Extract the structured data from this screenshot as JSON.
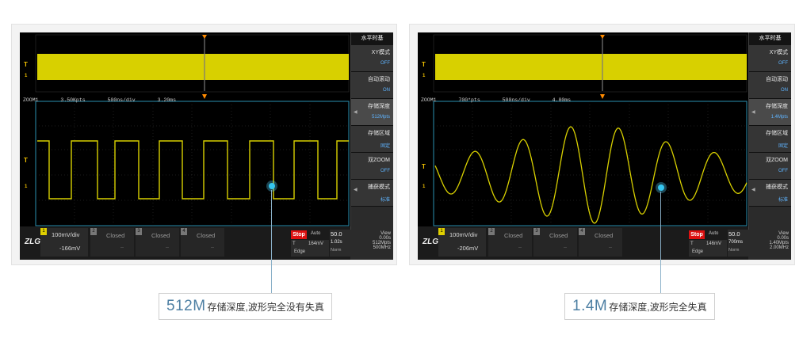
{
  "colors": {
    "trace": "#d8d000",
    "accent": "#4d7fa3",
    "stop": "#d11111"
  },
  "panels": [
    {
      "zoom_info": {
        "zoom": "ZOOM1",
        "pts": "3.50Kpts",
        "tdiv": "500ns/div",
        "pos": "3.20ms"
      },
      "menu": {
        "title": "水平时基",
        "items": [
          {
            "label": "XY模式",
            "value": "OFF"
          },
          {
            "label": "自动滚动",
            "value": "ON"
          },
          {
            "label": "存储深度",
            "value": "512Mpts"
          },
          {
            "label": "存储区域",
            "value": "固定"
          },
          {
            "label": "双ZOOM",
            "value": "OFF"
          },
          {
            "label": "捕获模式",
            "value": "标准"
          }
        ]
      },
      "bottom": {
        "logo": "ZLG",
        "ch1_num": "1",
        "ch1_scale": "100mV/div",
        "ch1_offset": "-166mV",
        "closed": [
          {
            "num": "2",
            "label": "Closed"
          },
          {
            "num": "3",
            "label": "Closed"
          },
          {
            "num": "4",
            "label": "Closed"
          }
        ],
        "closed_dash": "--",
        "stop": "Stop",
        "trig_mode": "Auto",
        "trig_t": "T",
        "trig_level": "164mV",
        "trig_type": "Edge",
        "tdiv": "1.02s",
        "norm": "Norm",
        "tb_value": "50.0",
        "tb_unit": "mV div",
        "view": "View",
        "view_t": "0.00s",
        "rec_len": "512Mpts",
        "rate": "500MHz"
      },
      "callout": {
        "big": "512M",
        "small": "存储深度,波形完全没有失真"
      }
    },
    {
      "zoom_info": {
        "zoom": "ZOOM1",
        "pts": "700*pts",
        "tdiv": "500ns/div",
        "pos": "4.80ms"
      },
      "menu": {
        "title": "水平时基",
        "items": [
          {
            "label": "XY模式",
            "value": "OFF"
          },
          {
            "label": "自动滚动",
            "value": "ON"
          },
          {
            "label": "存储深度",
            "value": "1.4Mpts"
          },
          {
            "label": "存储区域",
            "value": "固定"
          },
          {
            "label": "双ZOOM",
            "value": "OFF"
          },
          {
            "label": "捕获模式",
            "value": "标准"
          }
        ]
      },
      "bottom": {
        "logo": "ZLG",
        "ch1_num": "1",
        "ch1_scale": "100mV/div",
        "ch1_offset": "-206mV",
        "closed": [
          {
            "num": "2",
            "label": "Closed"
          },
          {
            "num": "3",
            "label": "Closed"
          },
          {
            "num": "4",
            "label": "Closed"
          }
        ],
        "closed_dash": "--",
        "stop": "Stop",
        "trig_mode": "Auto",
        "trig_t": "T",
        "trig_level": "146mV",
        "trig_type": "Edge",
        "tdiv": "700ms",
        "norm": "Norm",
        "tb_value": "50.0",
        "tb_unit": "mV div",
        "view": "View",
        "view_t": "0.00s",
        "rec_len": "1.40Mpts",
        "rate": "2.00MHz"
      },
      "callout": {
        "big": "1.4M",
        "small": "存储深度,波形完全失真"
      }
    }
  ],
  "markers": {
    "trigger": "T",
    "channel": "1"
  }
}
